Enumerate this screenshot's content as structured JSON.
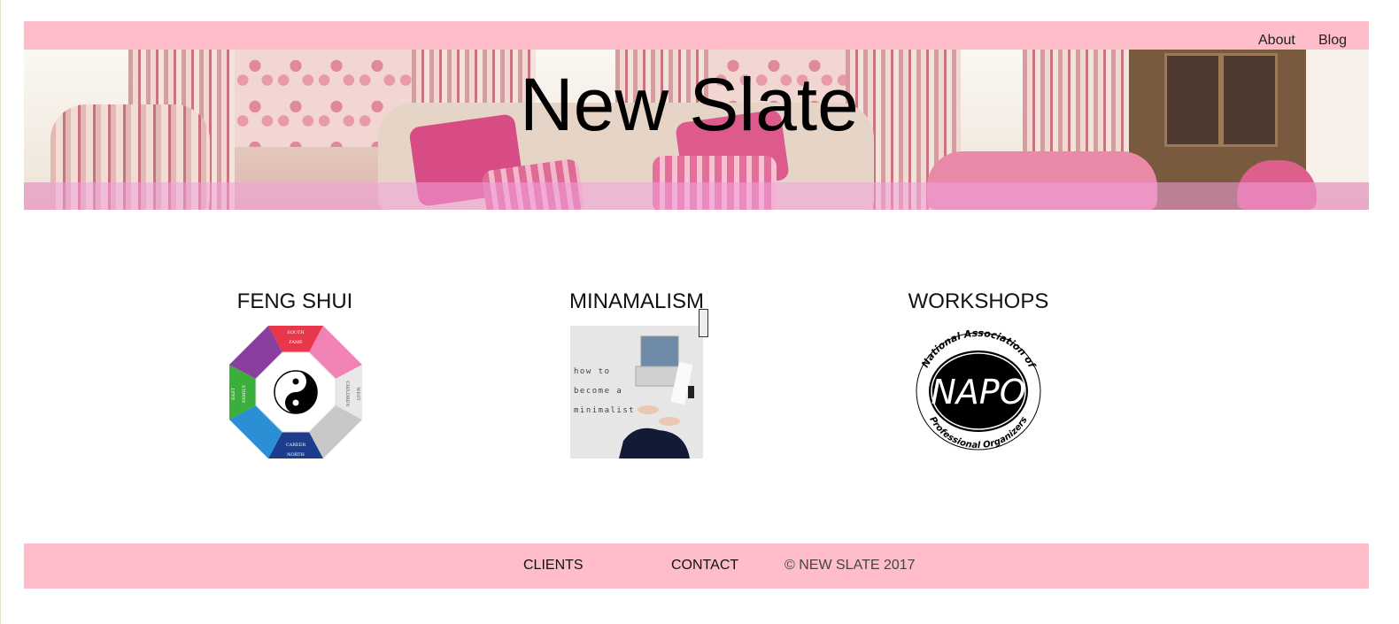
{
  "header": {
    "nav": [
      "About",
      "Blog"
    ],
    "site_title": "New Slate"
  },
  "sections": [
    {
      "title": "FENG SHUI",
      "image_icon": "bagua-map-image"
    },
    {
      "title": "MINAMALISM",
      "image_text": [
        "how to",
        "become a",
        "minimalist"
      ]
    },
    {
      "title": "WORKSHOPS",
      "logo_text": {
        "top": "National Association of",
        "center": "NAPO",
        "bottom": "Professional Organizers"
      }
    }
  ],
  "bagua": {
    "labels": [
      "SOUTH",
      "FAME",
      "NORTH",
      "CAREER",
      "EAST",
      "FAMILY",
      "WEST",
      "CHILDREN"
    ]
  },
  "footer": {
    "links": [
      "CLIENTS",
      "CONTACT"
    ],
    "copyright": "© NEW SLATE 2017"
  },
  "colors": {
    "header_bar": "#ffbcc9",
    "footer_bar": "#ffbcc9",
    "hero_band": "#f0a0dc"
  }
}
